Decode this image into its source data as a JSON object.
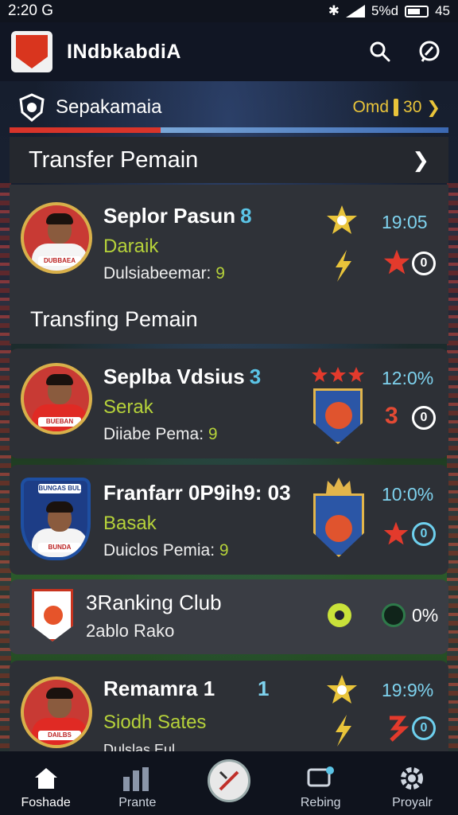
{
  "status_bar": {
    "time": "2:20 G",
    "battery": "45",
    "signal_text": "5%d"
  },
  "header": {
    "title": "INdbkabdiA"
  },
  "subheader": {
    "title": "Sepakamaia",
    "right_text": "Omd",
    "right_count": "30"
  },
  "section": {
    "title": "Transfer Pemain"
  },
  "mid_label": "Transfing Pemain",
  "players": [
    {
      "name": "Seplor Pasun",
      "number": "8",
      "position": "Daraik",
      "meta_label": "Dulsiabeemar:",
      "meta_value": "9",
      "time": "19:05",
      "right_value": "0",
      "avatar_tag": "DUBBAEA"
    },
    {
      "name": "Seplba Vdsius",
      "number": "3",
      "position": "Serak",
      "meta_label": "Diiabe Pema:",
      "meta_value": "9",
      "time": "12:0%",
      "right_count": "3",
      "right_value": "0",
      "avatar_tag": "BUEBAN"
    },
    {
      "name": "Franfarr 0P9ih9: 03",
      "number": "",
      "position": "Basak",
      "meta_label": "Duiclos Pemia:",
      "meta_value": "9",
      "time": "10:0%",
      "right_value": "0",
      "avatar_tag": "BUNDA",
      "shield_title": "BUNGAS BUL"
    },
    {
      "name": "Remamra 1",
      "number": "1",
      "position": "Siodh Sates",
      "meta_label": "Dulslas Eul",
      "meta_value": "",
      "time": "19:9%",
      "right_value": "0",
      "avatar_tag": "DAILBS"
    }
  ],
  "ranking": {
    "title": "3Ranking Club",
    "subtitle": "2ablo Rako",
    "value": "0%"
  },
  "nav": [
    {
      "label": "Foshade"
    },
    {
      "label": "Prante"
    },
    {
      "label": ""
    },
    {
      "label": "Rebing"
    },
    {
      "label": "Proyalr"
    }
  ],
  "colors": {
    "accent_red": "#d8342a",
    "accent_blue": "#5bc4e6",
    "accent_green": "#b6d23a",
    "gold": "#e9c43a"
  }
}
